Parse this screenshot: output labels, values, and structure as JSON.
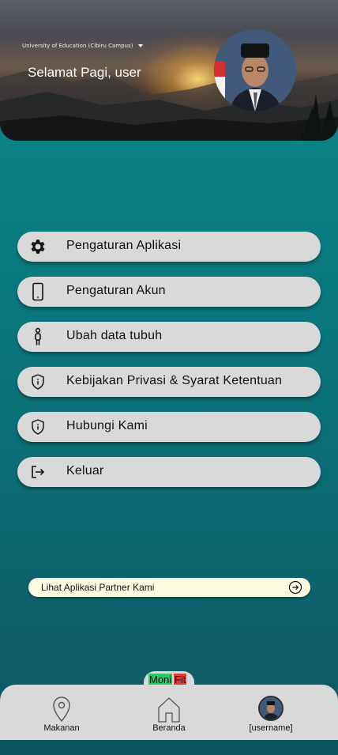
{
  "header": {
    "campus": "University of Education (Cibiru Campus)",
    "greeting": "Selamat Pagi, user"
  },
  "menu": {
    "items": [
      {
        "label": "Pengaturan Aplikasi",
        "icon": "gear-icon"
      },
      {
        "label": "Pengaturan Akun",
        "icon": "phone-icon"
      },
      {
        "label": "Ubah data tubuh",
        "icon": "person-icon"
      },
      {
        "label": "Kebijakan Privasi & Syarat Ketentuan",
        "icon": "shield-info-icon"
      },
      {
        "label": "Hubungi Kami",
        "icon": "shield-info-icon"
      },
      {
        "label": "Keluar",
        "icon": "logout-icon"
      }
    ]
  },
  "partner": {
    "label": "Lihat Aplikasi Partner Kami",
    "icon": "arrow-right-circle-icon"
  },
  "logo": {
    "part_a": "Moni",
    "part_b": "Fit",
    "color_a": "#2ec46b",
    "color_b": "#e53935"
  },
  "nav": {
    "items": [
      {
        "label": "Makanan",
        "icon": "map-pin-icon"
      },
      {
        "label": "Beranda",
        "icon": "home-icon"
      },
      {
        "label": "[username]",
        "icon": "avatar"
      }
    ]
  },
  "colors": {
    "background_top": "#0b8a8a",
    "background_bottom": "#0f5563",
    "menu_item": "#d9d9d9",
    "partner_bar": "#fdfbe0"
  }
}
